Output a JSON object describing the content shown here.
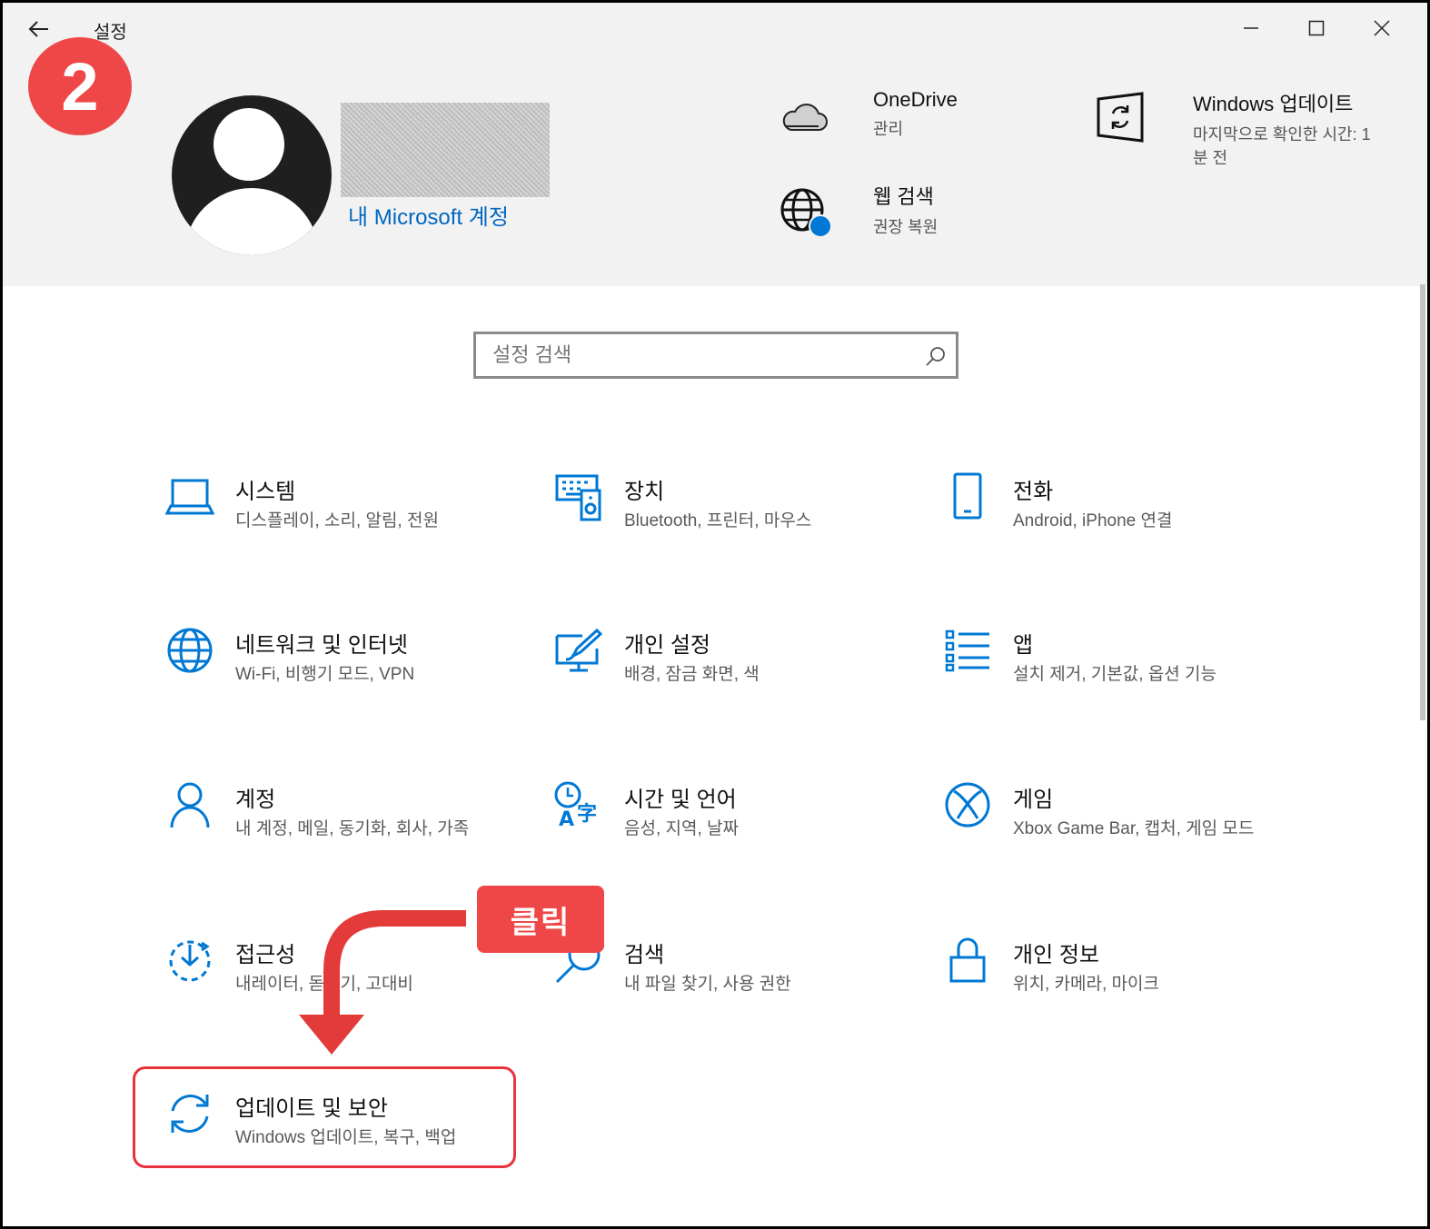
{
  "window": {
    "title": "설정",
    "back_label": "←"
  },
  "annotation": {
    "step_number": "2",
    "click_label": "클릭"
  },
  "account": {
    "link_label": "내 Microsoft 계정"
  },
  "quick_links": {
    "onedrive": {
      "title": "OneDrive",
      "subtitle": "관리"
    },
    "web_search": {
      "title": "웹 검색",
      "subtitle": "권장 복원"
    },
    "windows_update": {
      "title": "Windows 업데이트",
      "subtitle": "마지막으로 확인한 시간: 1분 전"
    }
  },
  "search": {
    "placeholder": "설정 검색"
  },
  "categories": [
    {
      "title": "시스템",
      "subtitle": "디스플레이, 소리, 알림, 전원",
      "icon": "laptop-icon"
    },
    {
      "title": "장치",
      "subtitle": "Bluetooth, 프린터, 마우스",
      "icon": "devices-icon"
    },
    {
      "title": "전화",
      "subtitle": "Android, iPhone 연결",
      "icon": "phone-icon"
    },
    {
      "title": "네트워크 및 인터넷",
      "subtitle": "Wi-Fi, 비행기 모드, VPN",
      "icon": "globe-icon"
    },
    {
      "title": "개인 설정",
      "subtitle": "배경, 잠금 화면, 색",
      "icon": "personalization-icon"
    },
    {
      "title": "앱",
      "subtitle": "설치 제거, 기본값, 옵션 기능",
      "icon": "apps-list-icon"
    },
    {
      "title": "계정",
      "subtitle": "내 계정, 메일, 동기화, 회사, 가족",
      "icon": "person-icon"
    },
    {
      "title": "시간 및 언어",
      "subtitle": "음성, 지역, 날짜",
      "icon": "time-language-icon"
    },
    {
      "title": "게임",
      "subtitle": "Xbox Game Bar, 캡처, 게임 모드",
      "icon": "xbox-icon"
    },
    {
      "title": "접근성",
      "subtitle": "내레이터, 돋보기, 고대비",
      "icon": "accessibility-icon"
    },
    {
      "title": "검색",
      "subtitle": "내 파일 찾기, 사용 권한",
      "icon": "search-icon"
    },
    {
      "title": "개인 정보",
      "subtitle": "위치, 카메라, 마이크",
      "icon": "lock-icon"
    },
    {
      "title": "업데이트 및 보안",
      "subtitle": "Windows 업데이트, 복구, 백업",
      "icon": "sync-icon"
    }
  ],
  "colors": {
    "accent": "#0067c0",
    "icon_blue": "#0078d4",
    "annotation_red": "#ef4747",
    "header_bg": "#f2f2f2"
  }
}
